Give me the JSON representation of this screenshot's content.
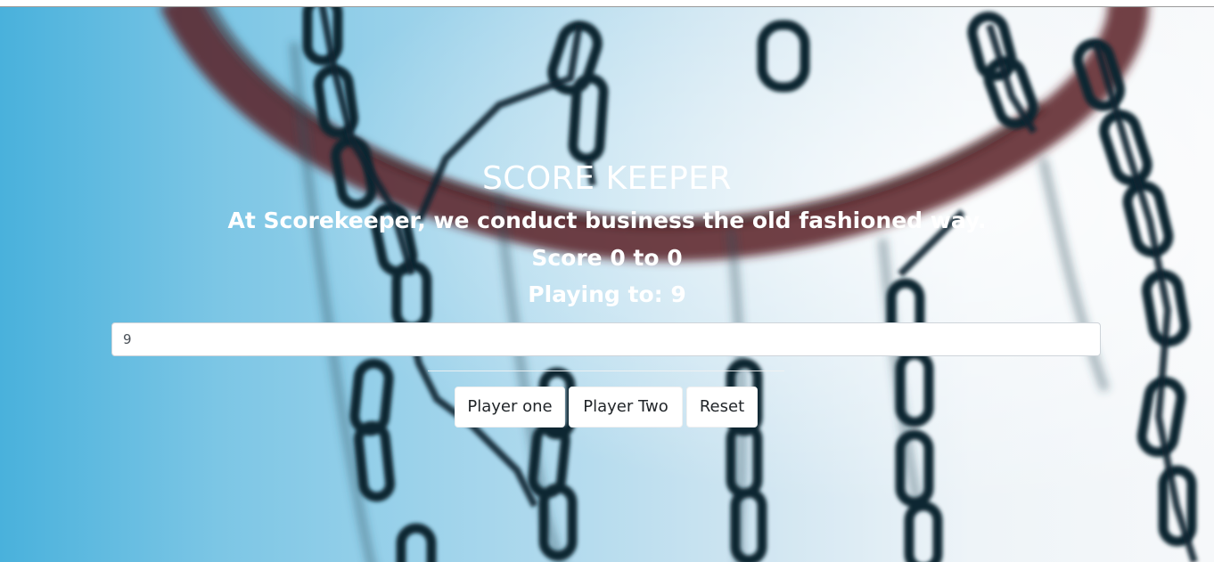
{
  "header": {
    "title": "SCORE KEEPER",
    "tagline": "At Scorekeeper, we conduct business the old fashioned way."
  },
  "scoreboard": {
    "score_text": "Score 0 to 0",
    "playing_to_text": "Playing to: 9"
  },
  "target_input": {
    "value": "9"
  },
  "controls": {
    "player_one_label": "Player one",
    "player_two_label": "Player Two",
    "reset_label": "Reset"
  },
  "background": {
    "subject": "basketball-net-chain-icon",
    "colors": {
      "sky_left": "#49b1dc",
      "sky_right": "#f6f8fa",
      "rim": "#5a1e24",
      "chain": "#142a35"
    }
  }
}
